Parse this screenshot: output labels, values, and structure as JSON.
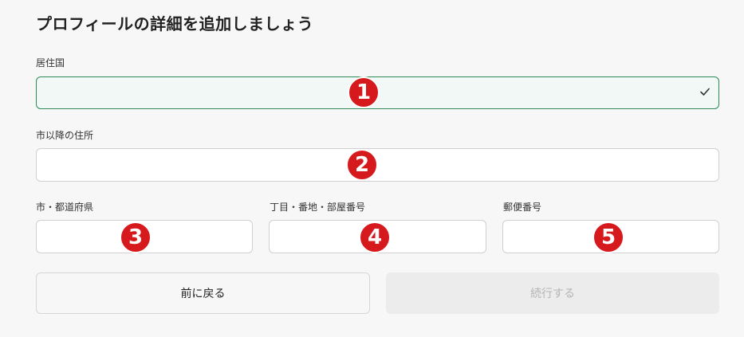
{
  "page": {
    "title": "プロフィールの詳細を追加しましょう"
  },
  "fields": {
    "country": {
      "label": "居住国",
      "value": ""
    },
    "address_line": {
      "label": "市以降の住所",
      "value": ""
    },
    "prefecture": {
      "label": "市・都道府県",
      "value": ""
    },
    "block": {
      "label": "丁目・番地・部屋番号",
      "value": ""
    },
    "postal": {
      "label": "郵便番号",
      "value": ""
    }
  },
  "markers": [
    "1",
    "2",
    "3",
    "4",
    "5"
  ],
  "buttons": {
    "back": "前に戻る",
    "next": "続行する"
  },
  "colors": {
    "marker": "#d6191d",
    "selected_border": "#2e8b57",
    "selected_bg": "#f2f8f5"
  },
  "icons": {
    "country_check": "check-icon"
  }
}
